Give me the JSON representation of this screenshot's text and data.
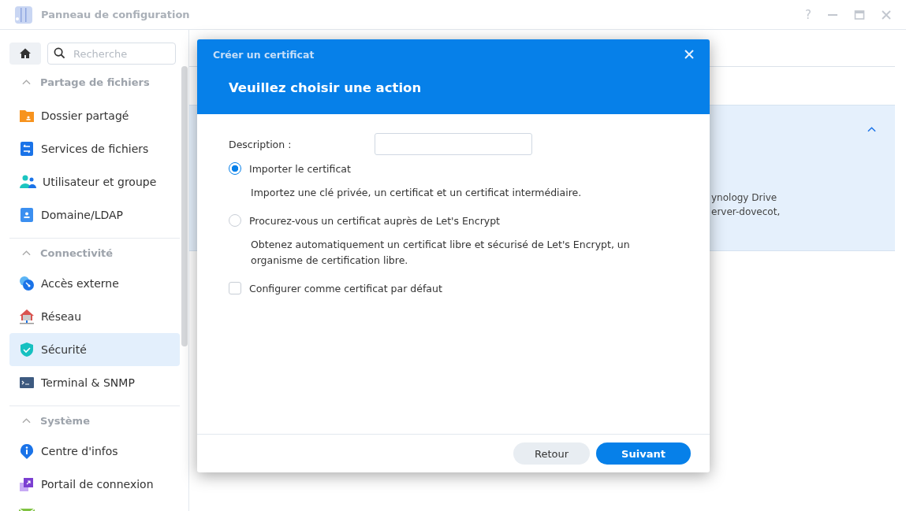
{
  "window": {
    "title": "Panneau de configuration",
    "help": "?"
  },
  "sidebar": {
    "search": {
      "placeholder": "Recherche"
    },
    "groups": [
      {
        "title": "Partage de fichiers",
        "expanded": true,
        "items": [
          {
            "label": "Dossier partagé",
            "kind": "folder",
            "selected": false
          },
          {
            "label": "Services de fichiers",
            "kind": "transfer",
            "selected": false
          },
          {
            "label": "Utilisateur et groupe",
            "kind": "users",
            "selected": false
          },
          {
            "label": "Domaine/LDAP",
            "kind": "directory",
            "selected": false
          }
        ]
      },
      {
        "title": "Connectivité",
        "expanded": true,
        "items": [
          {
            "label": "Accès externe",
            "kind": "external",
            "selected": false
          },
          {
            "label": "Réseau",
            "kind": "network",
            "selected": false
          },
          {
            "label": "Sécurité",
            "kind": "shield",
            "selected": true
          },
          {
            "label": "Terminal & SNMP",
            "kind": "terminal",
            "selected": false
          }
        ]
      },
      {
        "title": "Système",
        "expanded": true,
        "items": [
          {
            "label": "Centre d'infos",
            "kind": "info",
            "selected": false
          },
          {
            "label": "Portail de connexion",
            "kind": "portal",
            "selected": false
          }
        ]
      }
    ]
  },
  "background_panel": {
    "expanded": true,
    "lines": [
      "ynology Drive",
      "erver-dovecot,"
    ]
  },
  "dialog": {
    "title": "Créer un certificat",
    "heading": "Veuillez choisir une action",
    "description_label": "Description :",
    "options": [
      {
        "kind": "radio",
        "label": "Importer le certificat",
        "selected": true,
        "note": "Importez une clé privée, un certificat et un certificat intermédiaire."
      },
      {
        "kind": "radio",
        "label": "Procurez-vous un certificat auprès de Let's Encrypt",
        "selected": false,
        "note": "Obtenez automatiquement un certificat libre et sécurisé de Let's Encrypt, un organisme de certification libre."
      },
      {
        "kind": "checkbox",
        "label": "Configurer comme certificat par défaut",
        "checked": false
      }
    ],
    "buttons": [
      {
        "label": "Retour",
        "kind": "secondary"
      },
      {
        "label": "Suivant",
        "kind": "primary"
      }
    ]
  }
}
